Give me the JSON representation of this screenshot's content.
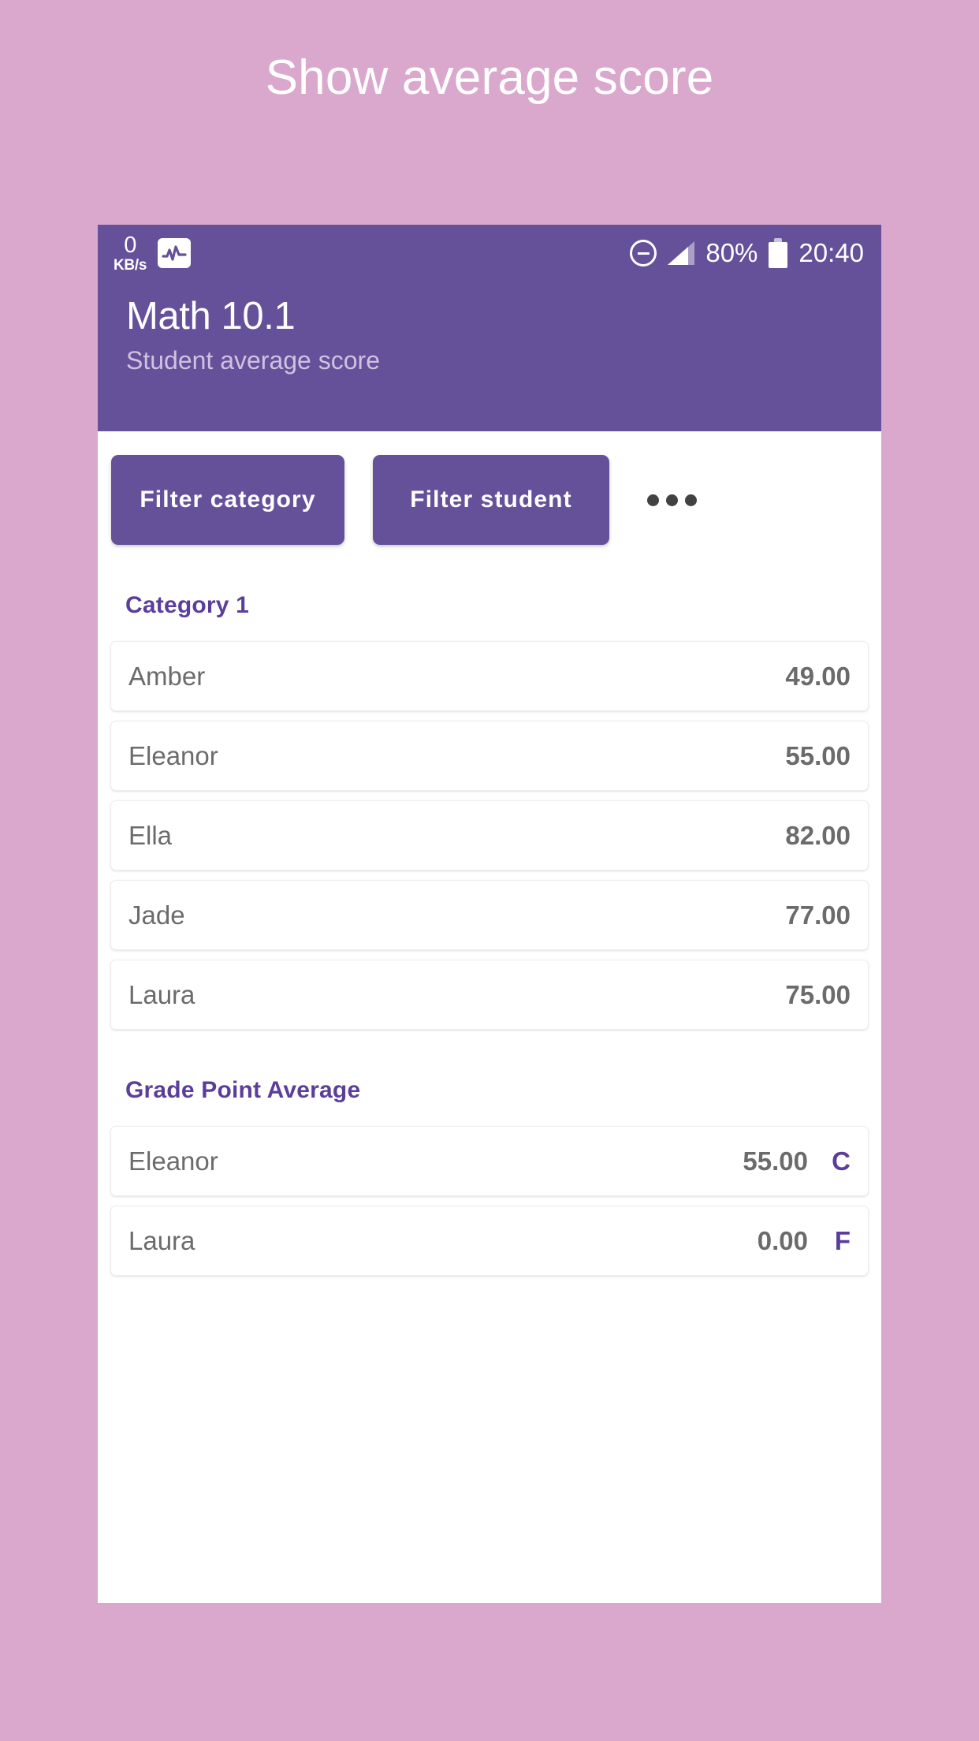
{
  "page": {
    "heading": "Show average score",
    "background_color": "#daa8cd"
  },
  "theme": {
    "primary_purple": "#65509a",
    "heading_purple": "#5b3e9b",
    "row_text_gray": "#6b6b6b",
    "subtitle_lavender": "#cfc2e0"
  },
  "statusbar": {
    "network_speed_value": "0",
    "network_speed_unit": "KB/s",
    "pulse_icon": "activity-pulse-icon",
    "dnd_icon": "do-not-disturb-icon",
    "signal_icon": "signal-bars-icon",
    "battery_percent": "80%",
    "battery_icon": "battery-icon",
    "clock": "20:40"
  },
  "appbar": {
    "title": "Math 10.1",
    "subtitle": "Student average score"
  },
  "toolbar": {
    "filter_category_label": "Filter category",
    "filter_student_label": "Filter student",
    "overflow_icon": "overflow-menu-icon"
  },
  "sections": [
    {
      "title": "Category 1",
      "rows": [
        {
          "name": "Amber",
          "score": "49.00",
          "grade": ""
        },
        {
          "name": "Eleanor",
          "score": "55.00",
          "grade": ""
        },
        {
          "name": "Ella",
          "score": "82.00",
          "grade": ""
        },
        {
          "name": "Jade",
          "score": "77.00",
          "grade": ""
        },
        {
          "name": "Laura",
          "score": "75.00",
          "grade": ""
        }
      ]
    },
    {
      "title": "Grade Point Average",
      "rows": [
        {
          "name": "Eleanor",
          "score": "55.00",
          "grade": "C"
        },
        {
          "name": "Laura",
          "score": "0.00",
          "grade": "F"
        }
      ]
    }
  ]
}
